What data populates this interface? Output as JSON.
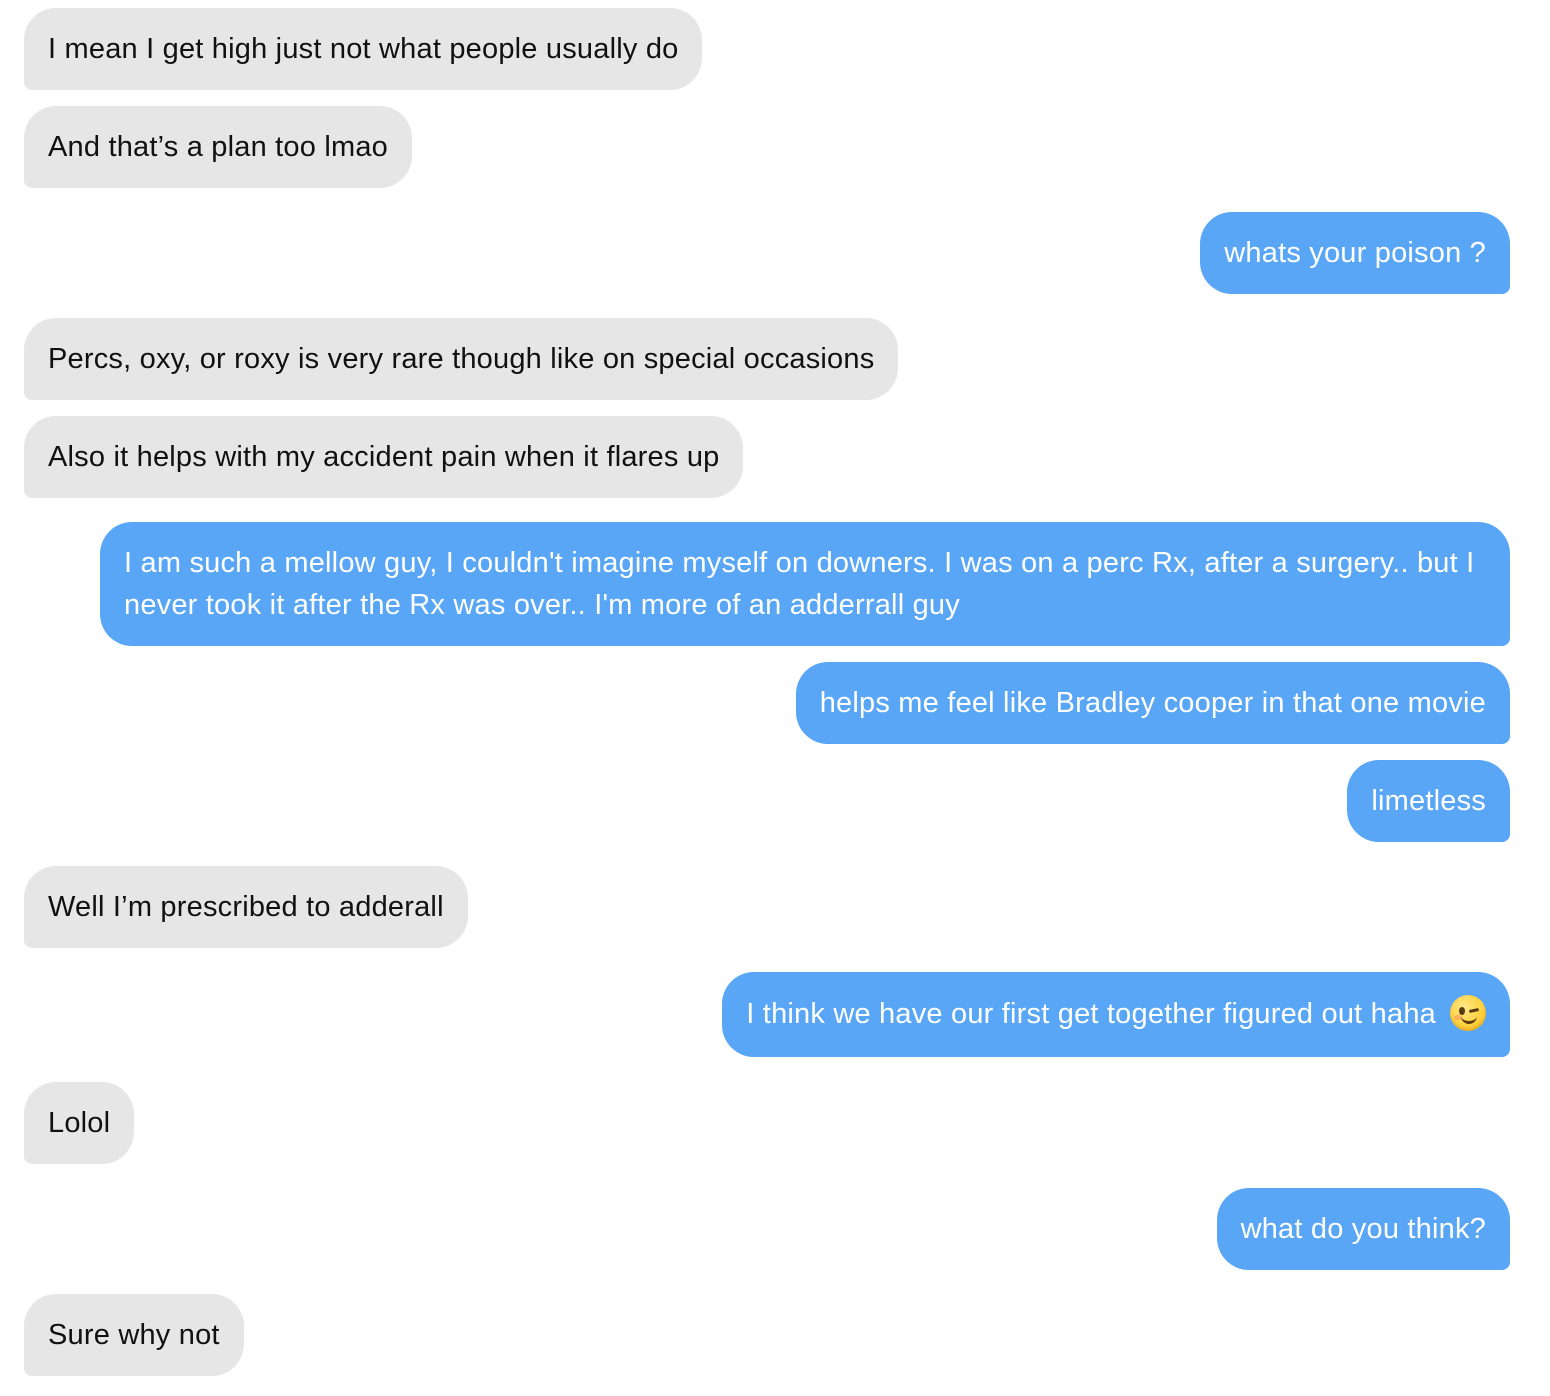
{
  "messages": [
    {
      "side": "in",
      "text": "I mean I get high just not what people usually do"
    },
    {
      "side": "in",
      "text": "And that’s a plan too lmao"
    },
    {
      "side": "out",
      "text": "whats your poison ?"
    },
    {
      "side": "in",
      "text": "Percs, oxy, or roxy is very rare though like on special occasions"
    },
    {
      "side": "in",
      "text": "Also it helps with my accident pain when it flares up"
    },
    {
      "side": "out",
      "text": "I am such a mellow guy, I couldn't imagine myself on downers. I was on a perc Rx, after a surgery.. but I never took it after the Rx was over.. I'm more of an adderrall guy"
    },
    {
      "side": "out",
      "text": "helps me feel like Bradley cooper in that one movie"
    },
    {
      "side": "out",
      "text": "limetless"
    },
    {
      "side": "in",
      "text": "Well I’m prescribed to adderall"
    },
    {
      "side": "out",
      "text": "I think we have our first get together figured out haha",
      "emoji": "winking-face"
    },
    {
      "side": "in",
      "text": "Lolol"
    },
    {
      "side": "out",
      "text": "what do you think?"
    },
    {
      "side": "in",
      "text": "Sure why not"
    }
  ],
  "colors": {
    "incoming_bubble": "#e6e6e6",
    "outgoing_bubble": "#58a6f5",
    "incoming_text": "#111111",
    "outgoing_text": "#ffffff"
  }
}
